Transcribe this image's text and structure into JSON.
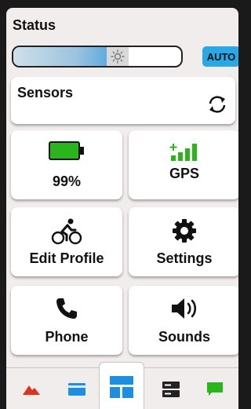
{
  "status": {
    "title": "Status"
  },
  "brightness": {
    "level": 0.62,
    "auto_label": "AUTO"
  },
  "sensors": {
    "label": "Sensors",
    "icon": "refresh-icon"
  },
  "tiles": {
    "battery": {
      "label": "99%",
      "icon": "battery-icon",
      "color": "#2bb51c"
    },
    "gps": {
      "label": "GPS",
      "icon": "gps-signal-icon",
      "color": "#2bb51c"
    },
    "edit_profile": {
      "label": "Edit Profile",
      "icon": "cyclist-icon"
    },
    "settings": {
      "label": "Settings",
      "icon": "gear-icon"
    },
    "phone": {
      "label": "Phone",
      "icon": "phone-icon"
    },
    "sounds": {
      "label": "Sounds",
      "icon": "speaker-icon"
    }
  },
  "nav": {
    "items": [
      {
        "icon": "mountain-icon",
        "color": "#e0301e"
      },
      {
        "icon": "card-icon",
        "color": "#1e8fe0"
      },
      {
        "icon": "widgets-icon",
        "color": "#1e8fe0",
        "active": true
      },
      {
        "icon": "storage-icon",
        "color": "#222222"
      },
      {
        "icon": "message-icon",
        "color": "#2bb51c"
      }
    ]
  },
  "colors": {
    "accent": "#2aa8e6",
    "background": "#f1eded"
  }
}
